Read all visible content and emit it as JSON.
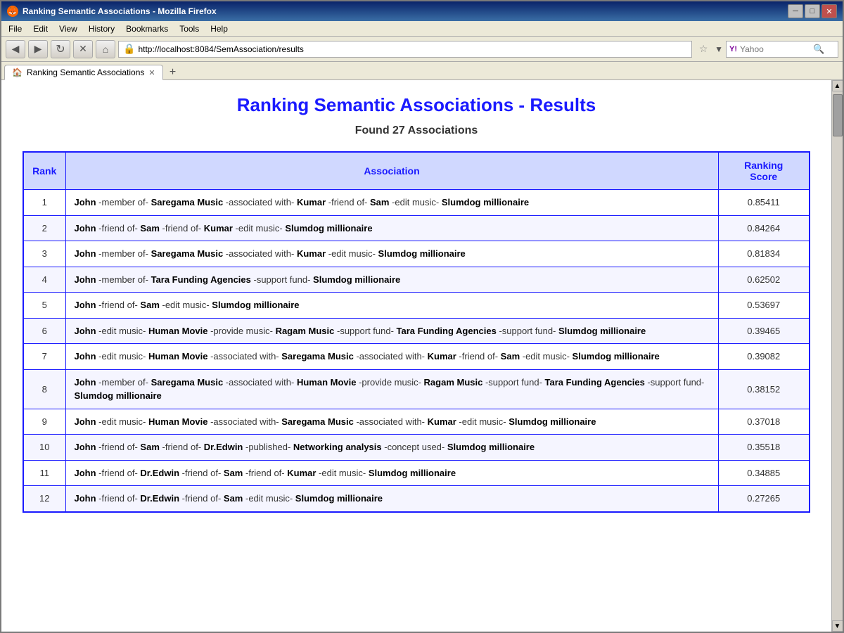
{
  "browser": {
    "title": "Ranking Semantic Associations - Mozilla Firefox",
    "icon": "🦊",
    "url": "http://localhost:8084/SemAssociation/results",
    "tab_title": "Ranking Semantic Associations",
    "menu_items": [
      "File",
      "Edit",
      "View",
      "History",
      "Bookmarks",
      "Tools",
      "Help"
    ],
    "search_placeholder": "Yahoo",
    "new_tab_symbol": "+"
  },
  "page": {
    "title": "Ranking Semantic Associations - Results",
    "subtitle": "Found 27 Associations",
    "table": {
      "headers": {
        "rank": "Rank",
        "association": "Association",
        "score": "Ranking Score"
      },
      "rows": [
        {
          "rank": 1,
          "score": "0.85411",
          "parts": [
            {
              "text": "John",
              "bold": true
            },
            {
              "text": " -member of- ",
              "bold": false
            },
            {
              "text": "Saregama Music",
              "bold": true
            },
            {
              "text": " -associated with- ",
              "bold": false
            },
            {
              "text": "Kumar",
              "bold": true
            },
            {
              "text": " -friend of- ",
              "bold": false
            },
            {
              "text": "Sam",
              "bold": true
            },
            {
              "text": " -edit music- ",
              "bold": false
            },
            {
              "text": "Slumdog millionaire",
              "bold": true
            }
          ]
        },
        {
          "rank": 2,
          "score": "0.84264",
          "parts": [
            {
              "text": "John",
              "bold": true
            },
            {
              "text": " -friend of- ",
              "bold": false
            },
            {
              "text": "Sam",
              "bold": true
            },
            {
              "text": " -friend of- ",
              "bold": false
            },
            {
              "text": "Kumar",
              "bold": true
            },
            {
              "text": " -edit music- ",
              "bold": false
            },
            {
              "text": "Slumdog millionaire",
              "bold": true
            }
          ]
        },
        {
          "rank": 3,
          "score": "0.81834",
          "parts": [
            {
              "text": "John",
              "bold": true
            },
            {
              "text": " -member of- ",
              "bold": false
            },
            {
              "text": "Saregama Music",
              "bold": true
            },
            {
              "text": " -associated with- ",
              "bold": false
            },
            {
              "text": "Kumar",
              "bold": true
            },
            {
              "text": " -edit music- ",
              "bold": false
            },
            {
              "text": "Slumdog millionaire",
              "bold": true
            }
          ]
        },
        {
          "rank": 4,
          "score": "0.62502",
          "parts": [
            {
              "text": "John",
              "bold": true
            },
            {
              "text": " -member of- ",
              "bold": false
            },
            {
              "text": "Tara Funding Agencies",
              "bold": true
            },
            {
              "text": " -support fund- ",
              "bold": false
            },
            {
              "text": "Slumdog millionaire",
              "bold": true
            }
          ]
        },
        {
          "rank": 5,
          "score": "0.53697",
          "parts": [
            {
              "text": "John",
              "bold": true
            },
            {
              "text": " -friend of- ",
              "bold": false
            },
            {
              "text": "Sam",
              "bold": true
            },
            {
              "text": " -edit music- ",
              "bold": false
            },
            {
              "text": "Slumdog millionaire",
              "bold": true
            }
          ]
        },
        {
          "rank": 6,
          "score": "0.39465",
          "parts": [
            {
              "text": "John",
              "bold": true
            },
            {
              "text": " -edit music- ",
              "bold": false
            },
            {
              "text": "Human Movie",
              "bold": true
            },
            {
              "text": " -provide music- ",
              "bold": false
            },
            {
              "text": "Ragam Music",
              "bold": true
            },
            {
              "text": " -support fund- ",
              "bold": false
            },
            {
              "text": "Tara Funding Agencies",
              "bold": true
            },
            {
              "text": " -support fund- ",
              "bold": false
            },
            {
              "text": "Slumdog millionaire",
              "bold": true
            }
          ]
        },
        {
          "rank": 7,
          "score": "0.39082",
          "parts": [
            {
              "text": "John",
              "bold": true
            },
            {
              "text": " -edit music- ",
              "bold": false
            },
            {
              "text": "Human Movie",
              "bold": true
            },
            {
              "text": " -associated with- ",
              "bold": false
            },
            {
              "text": "Saregama Music",
              "bold": true
            },
            {
              "text": " -associated with- ",
              "bold": false
            },
            {
              "text": "Kumar",
              "bold": true
            },
            {
              "text": " -friend of- ",
              "bold": false
            },
            {
              "text": "Sam",
              "bold": true
            },
            {
              "text": " -edit music- ",
              "bold": false
            },
            {
              "text": "Slumdog millionaire",
              "bold": true
            }
          ]
        },
        {
          "rank": 8,
          "score": "0.38152",
          "parts": [
            {
              "text": "John",
              "bold": true
            },
            {
              "text": " -member of- ",
              "bold": false
            },
            {
              "text": "Saregama Music",
              "bold": true
            },
            {
              "text": " -associated with- ",
              "bold": false
            },
            {
              "text": "Human Movie",
              "bold": true
            },
            {
              "text": " -provide music- ",
              "bold": false
            },
            {
              "text": "Ragam Music",
              "bold": true
            },
            {
              "text": " -support fund- ",
              "bold": false
            },
            {
              "text": "Tara Funding Agencies",
              "bold": true
            },
            {
              "text": " -support fund- ",
              "bold": false
            },
            {
              "text": "Slumdog millionaire",
              "bold": true
            }
          ]
        },
        {
          "rank": 9,
          "score": "0.37018",
          "parts": [
            {
              "text": "John",
              "bold": true
            },
            {
              "text": " -edit music- ",
              "bold": false
            },
            {
              "text": "Human Movie",
              "bold": true
            },
            {
              "text": " -associated with- ",
              "bold": false
            },
            {
              "text": "Saregama Music",
              "bold": true
            },
            {
              "text": " -associated with- ",
              "bold": false
            },
            {
              "text": "Kumar",
              "bold": true
            },
            {
              "text": " -edit music- ",
              "bold": false
            },
            {
              "text": "Slumdog millionaire",
              "bold": true
            }
          ]
        },
        {
          "rank": 10,
          "score": "0.35518",
          "parts": [
            {
              "text": "John",
              "bold": true
            },
            {
              "text": " -friend of- ",
              "bold": false
            },
            {
              "text": "Sam",
              "bold": true
            },
            {
              "text": " -friend of- ",
              "bold": false
            },
            {
              "text": "Dr.Edwin",
              "bold": true
            },
            {
              "text": " -published- ",
              "bold": false
            },
            {
              "text": "Networking analysis",
              "bold": true
            },
            {
              "text": " -concept used- ",
              "bold": false
            },
            {
              "text": "Slumdog millionaire",
              "bold": true
            }
          ]
        },
        {
          "rank": 11,
          "score": "0.34885",
          "parts": [
            {
              "text": "John",
              "bold": true
            },
            {
              "text": " -friend of- ",
              "bold": false
            },
            {
              "text": "Dr.Edwin",
              "bold": true
            },
            {
              "text": " -friend of- ",
              "bold": false
            },
            {
              "text": "Sam",
              "bold": true
            },
            {
              "text": " -friend of- ",
              "bold": false
            },
            {
              "text": "Kumar",
              "bold": true
            },
            {
              "text": " -edit music- ",
              "bold": false
            },
            {
              "text": "Slumdog millionaire",
              "bold": true
            }
          ]
        },
        {
          "rank": 12,
          "score": "0.27265",
          "parts": [
            {
              "text": "John",
              "bold": true
            },
            {
              "text": " -friend of- ",
              "bold": false
            },
            {
              "text": "Dr.Edwin",
              "bold": true
            },
            {
              "text": " -friend of- ",
              "bold": false
            },
            {
              "text": "Sam",
              "bold": true
            },
            {
              "text": " -edit music- ",
              "bold": false
            },
            {
              "text": "Slumdog millionaire",
              "bold": true
            }
          ]
        }
      ]
    }
  }
}
